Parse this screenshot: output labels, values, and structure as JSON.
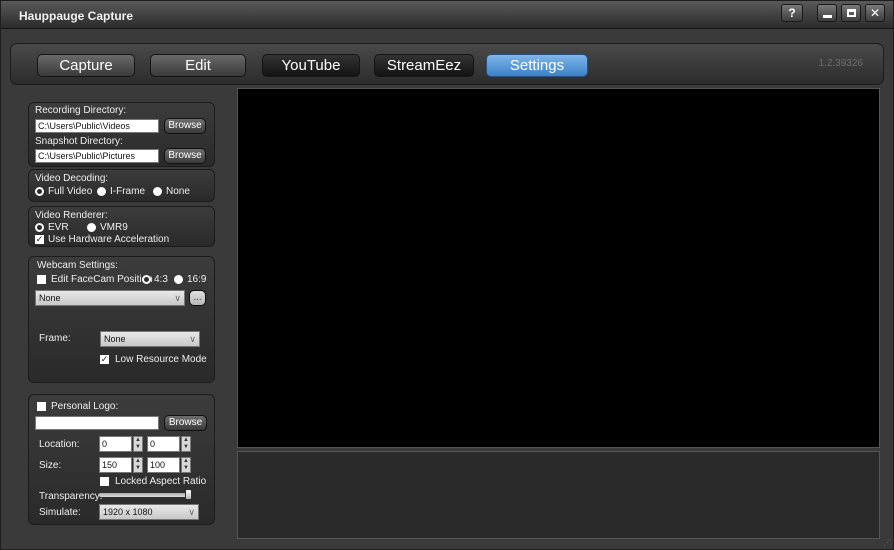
{
  "window": {
    "title": "Hauppauge Capture"
  },
  "window_buttons": {
    "help": "?"
  },
  "tabs": [
    {
      "label": "Capture"
    },
    {
      "label": "Edit"
    },
    {
      "label": "YouTube"
    },
    {
      "label": "StreamEez"
    },
    {
      "label": "Settings"
    }
  ],
  "version": "1.2.39326",
  "directories": {
    "recording_label": "Recording Directory:",
    "recording_value": "C:\\Users\\Public\\Videos",
    "snapshot_label": "Snapshot Directory:",
    "snapshot_value": "C:\\Users\\Public\\Pictures",
    "browse_label": "Browse"
  },
  "video_decoding": {
    "label": "Video Decoding:",
    "options": [
      "Full Video",
      "I-Frame",
      "None"
    ],
    "selected": "Full Video"
  },
  "video_renderer": {
    "label": "Video Renderer:",
    "options": [
      "EVR",
      "VMR9"
    ],
    "selected": "EVR",
    "hw_accel_label": "Use Hardware Acceleration",
    "hw_accel_checked": true
  },
  "webcam": {
    "label": "Webcam Settings:",
    "edit_facecam_label": "Edit FaceCam Position",
    "edit_facecam_checked": false,
    "aspect_options": [
      "4:3",
      "16:9"
    ],
    "aspect_selected": "4:3",
    "device_value": "None",
    "more_label": "...",
    "frame_label": "Frame:",
    "frame_value": "None",
    "low_resource_label": "Low Resource Mode",
    "low_resource_checked": true
  },
  "logo": {
    "label": "Personal Logo:",
    "checked": false,
    "path_value": "",
    "browse_label": "Browse",
    "location_label": "Location:",
    "location_x": "0",
    "location_y": "0",
    "size_label": "Size:",
    "size_w": "150",
    "size_h": "100",
    "locked_aspect_label": "Locked Aspect Ratio",
    "locked_aspect_checked": false,
    "transparency_label": "Transparency:",
    "transparency_value": 1.0,
    "simulate_label": "Simulate:",
    "simulate_value": "1920 x 1080"
  }
}
